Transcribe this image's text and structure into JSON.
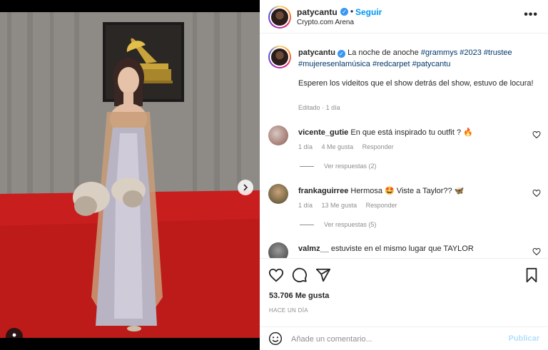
{
  "post": {
    "username": "patycantu",
    "follow_label": "Seguir",
    "separator": "•",
    "location": "Crypto.com Arena",
    "more_label": "•••"
  },
  "caption": {
    "username": "patycantu",
    "text": "La noche de anoche",
    "hashtags": [
      "#grammys",
      "#2023",
      "#trustee",
      "#mujeresenlamúsica",
      "#redcarpet",
      "#patycantu"
    ],
    "text2": "Esperen los videitos que el show detrás del show, estuvo de locura!",
    "edited": "Editado",
    "age": "1 día"
  },
  "comments": [
    {
      "username": "vicente_gutie",
      "text": "En que está inspirado tu outfit ? 🔥",
      "age": "1 día",
      "likes": "4 Me gusta",
      "reply": "Responder",
      "view_replies": "Ver respuestas (2)"
    },
    {
      "username": "frankaguirree",
      "text": "Hermosa 🤩 Viste a Taylor?? 🦋",
      "age": "1 día",
      "likes": "13 Me gusta",
      "reply": "Responder",
      "view_replies": "Ver respuestas (5)"
    },
    {
      "username": "valmz__",
      "text": "estuviste en el mismo lugar que TAYLOR"
    }
  ],
  "stats": {
    "likes": "53.706 Me gusta",
    "time": "HACE UN DÍA"
  },
  "comment_box": {
    "placeholder": "Añade un comentario...",
    "publish": "Publicar"
  },
  "colors": {
    "accent": "#0095f6",
    "hashtag": "#00376b",
    "muted": "#8e8e8e",
    "carpet": "#c81e1e"
  },
  "icons": [
    "verified-icon",
    "chevron-right-icon",
    "user-tag-icon",
    "heart-icon",
    "comment-icon",
    "share-icon",
    "bookmark-icon",
    "emoji-icon"
  ]
}
